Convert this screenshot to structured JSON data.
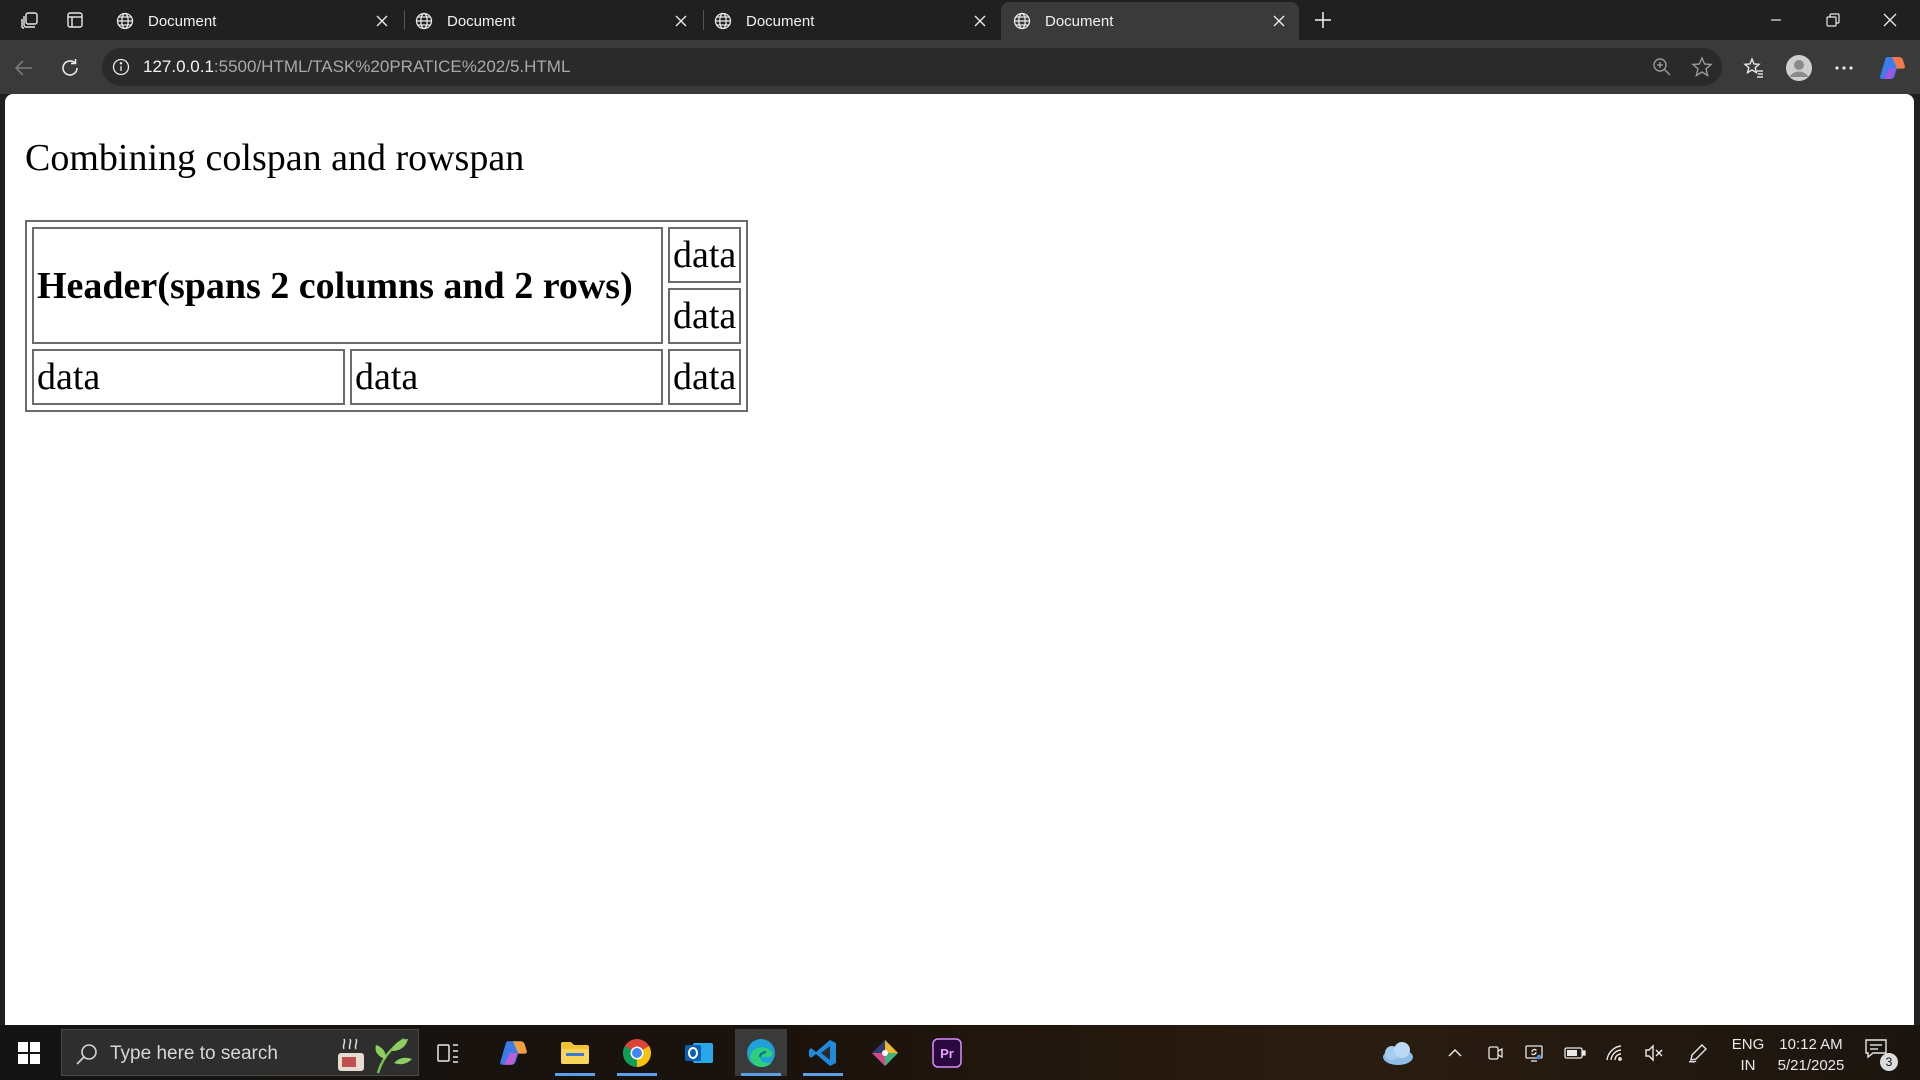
{
  "browser": {
    "tabs": [
      {
        "title": "Document",
        "active": false
      },
      {
        "title": "Document",
        "active": false
      },
      {
        "title": "Document",
        "active": false
      },
      {
        "title": "Document",
        "active": true
      }
    ],
    "url_host": "127.0.0.1",
    "url_rest": ":5500/HTML/TASK%20PRATICE%202/5.HTML"
  },
  "page": {
    "heading": "Combining colspan and rowspan",
    "table": {
      "header": "Header(spans 2 columns and 2 rows)",
      "row1_right": "data",
      "row2_right": "data",
      "row3": [
        "data",
        "data",
        "data"
      ]
    }
  },
  "taskbar": {
    "search_placeholder": "Type here to search",
    "language_line1": "ENG",
    "language_line2": "IN",
    "time": "10:12 AM",
    "date": "5/21/2025",
    "notification_count": "3"
  },
  "colors": {
    "tab_bar": "#202020",
    "toolbar": "#3a3a3a",
    "page_background": "#ffffff",
    "table_border": "#6b6b6b"
  }
}
